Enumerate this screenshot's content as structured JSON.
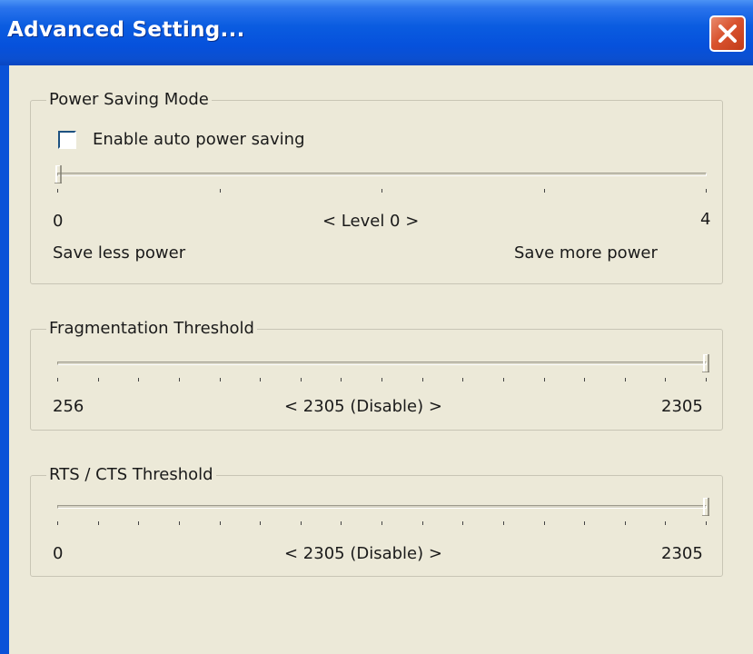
{
  "window": {
    "title": "Advanced Setting...",
    "close_icon": "close-icon",
    "colors": {
      "titlebar": "#0651dc",
      "close": "#d9532f",
      "client": "#ece9d8"
    }
  },
  "power_saving": {
    "group_label": "Power Saving Mode",
    "checkbox_label": "Enable auto power saving",
    "checked": false,
    "slider": {
      "min": 0,
      "max": 4,
      "value": 0,
      "tick_count": 5
    },
    "min_label": "0",
    "max_label": "4",
    "value_label": "< Level 0 >",
    "left_caption": "Save less power",
    "right_caption": "Save more power"
  },
  "fragmentation": {
    "group_label": "Fragmentation Threshold",
    "slider": {
      "min": 256,
      "max": 2305,
      "value": 2305,
      "tick_count": 17
    },
    "min_label": "256",
    "max_label": "2305",
    "value_label": "< 2305 (Disable) >"
  },
  "rts_cts": {
    "group_label": "RTS / CTS Threshold",
    "slider": {
      "min": 0,
      "max": 2305,
      "value": 2305,
      "tick_count": 17
    },
    "min_label": "0",
    "max_label": "2305",
    "value_label": "< 2305 (Disable) >"
  }
}
